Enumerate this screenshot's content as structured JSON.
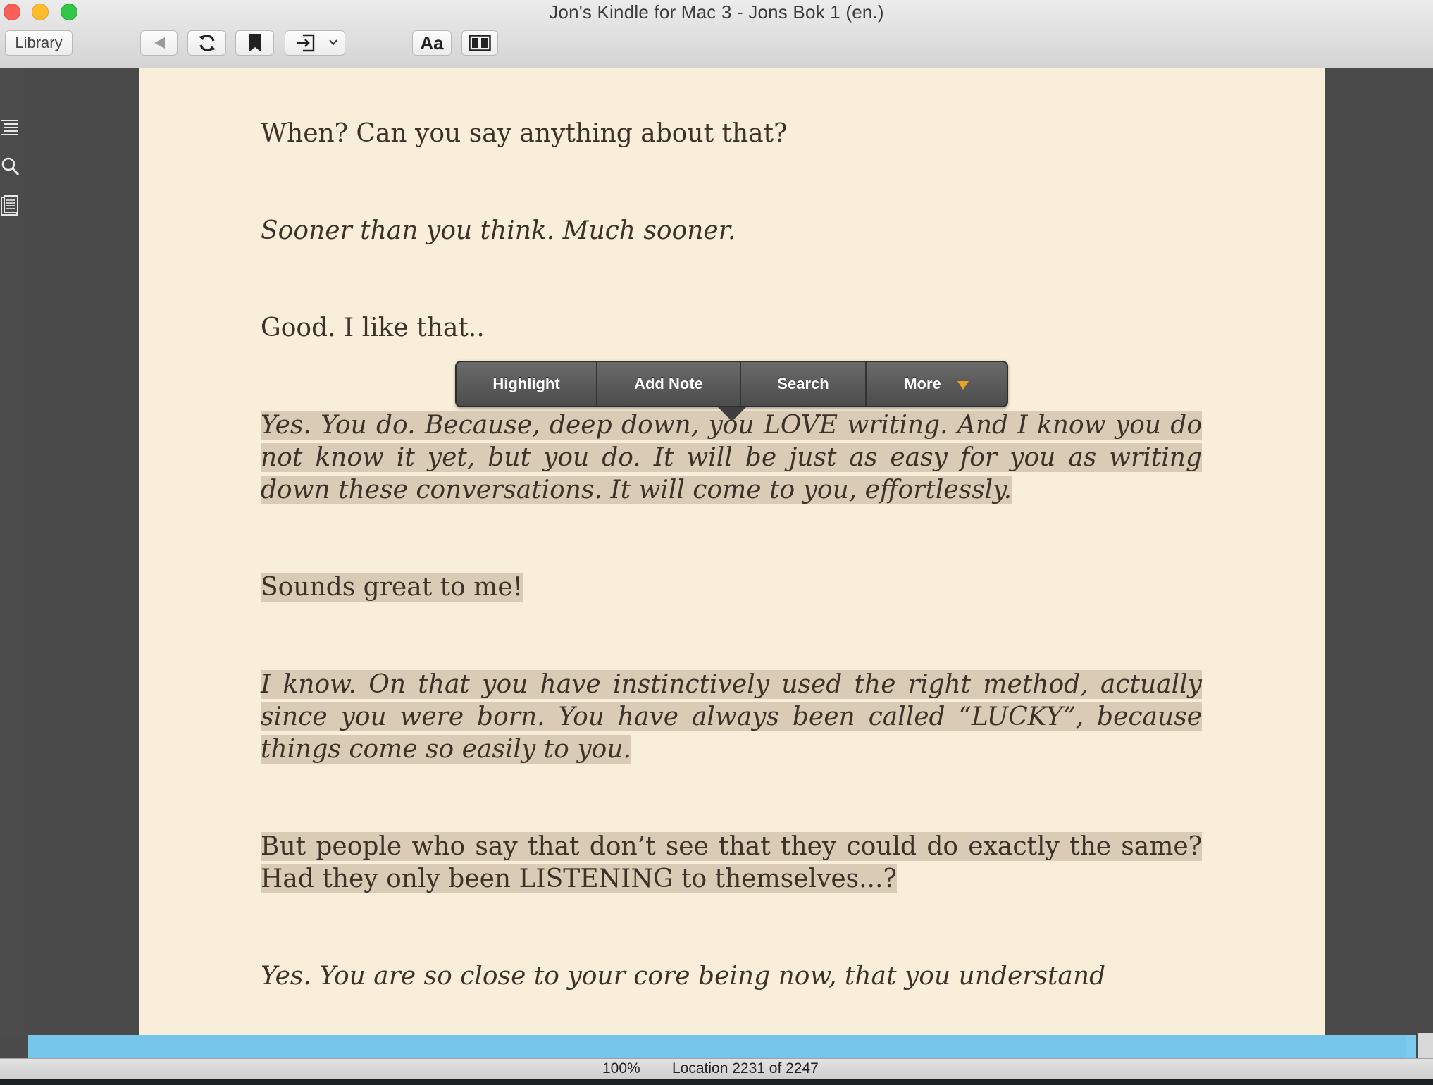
{
  "window": {
    "title": "Jon's Kindle for Mac 3 - Jons Bok 1 (en.)"
  },
  "toolbar": {
    "library_label": "Library",
    "back_icon": "back-arrow-icon",
    "sync_icon": "sync-icon",
    "bookmark_icon": "bookmark-icon",
    "goto_icon": "goto-icon",
    "font_label": "Aa",
    "columns_icon": "columns-icon"
  },
  "sidebar": {
    "icons": [
      "table-of-contents-icon",
      "search-icon",
      "notes-icon"
    ]
  },
  "page": {
    "paragraphs": [
      {
        "text": "When? Can you say anything about that?",
        "italic": false,
        "highlighted": false
      },
      {
        "text": "Sooner than you think. Much sooner.",
        "italic": true,
        "highlighted": false
      },
      {
        "text": "Good. I like that..",
        "italic": false,
        "highlighted": false
      },
      {
        "text": "Yes. You do. Because, deep down, you LOVE writing. And I know you do not know it yet, but you do. It will be just as easy for you as writing down these conversations. It will come to you, effortlessly.",
        "italic": true,
        "highlighted": true
      },
      {
        "text": "Sounds great to me!",
        "italic": false,
        "highlighted": true
      },
      {
        "text": "I know. On that you have instinctively used the right method, actually since you were born. You have always been called “LUCKY”, because things come so easily to you.",
        "italic": true,
        "highlighted": true
      },
      {
        "text": "But people who say that don’t see that they could do exactly the same? Had they only been LISTENING to themselves...?",
        "italic": false,
        "highlighted": true
      },
      {
        "text": "Yes. You are so close to your core being now, that you understand",
        "italic": true,
        "highlighted": false
      }
    ]
  },
  "popup": {
    "highlight": "Highlight",
    "add_note": "Add Note",
    "search": "Search",
    "more": "More",
    "more_accent": "#f0a020"
  },
  "status": {
    "zoom": "100%",
    "location": "Location 2231 of 2247",
    "progress_fraction": 0.993,
    "progress_color": "#7dcaec"
  }
}
